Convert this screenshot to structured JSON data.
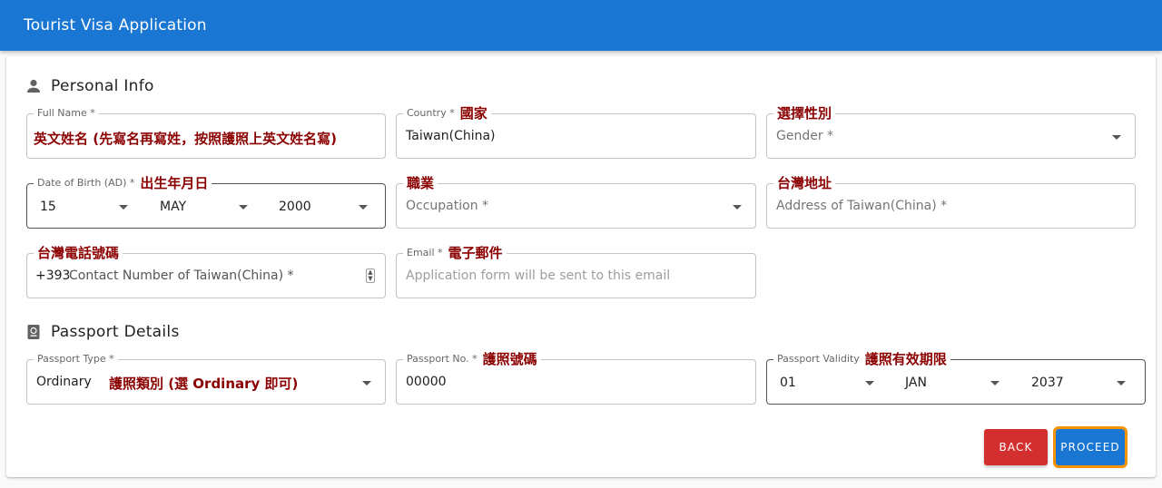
{
  "appbar": {
    "title": "Tourist Visa Application"
  },
  "personal": {
    "heading": "Personal Info",
    "full_name": {
      "label": "Full Name *",
      "value": "英文姓名 (先寫名再寫姓，按照護照上英文姓名寫)"
    },
    "country": {
      "label": "Country *",
      "note": "國家",
      "value": "Taiwan(China)"
    },
    "gender": {
      "note": "選擇性別",
      "placeholder": "Gender *"
    },
    "dob": {
      "label": "Date of Birth (AD) *",
      "note": "出生年月日",
      "day": "15",
      "month": "MAY",
      "year": "2000"
    },
    "occupation": {
      "note": "職業",
      "placeholder": "Occupation *"
    },
    "address": {
      "note": "台灣地址",
      "placeholder": "Address of Taiwan(China) *"
    },
    "phone": {
      "note": "台灣電話號碼",
      "prefix": "+393",
      "placeholder": "Contact Number of Taiwan(China) *"
    },
    "email": {
      "label": "Email *",
      "note": "電子郵件",
      "placeholder": "Application form will be sent to this email"
    }
  },
  "passport": {
    "heading": "Passport Details",
    "type": {
      "label": "Passport Type *",
      "value": "Ordinary",
      "note": "護照類別 (選 Ordinary 即可)"
    },
    "number": {
      "label": "Passport No. *",
      "note": "護照號碼",
      "value": "00000"
    },
    "validity": {
      "label": "Passport Validity",
      "note": "護照有效期限",
      "day": "01",
      "month": "JAN",
      "year": "2037"
    }
  },
  "actions": {
    "back": "BACK",
    "proceed": "PROCEED"
  },
  "colors": {
    "primary": "#1976d2",
    "danger": "#d32f2f",
    "focus_outline": "#f59300",
    "annotation": "#8b0000"
  },
  "icons": {
    "personal": "person-icon",
    "passport": "passport-icon"
  }
}
